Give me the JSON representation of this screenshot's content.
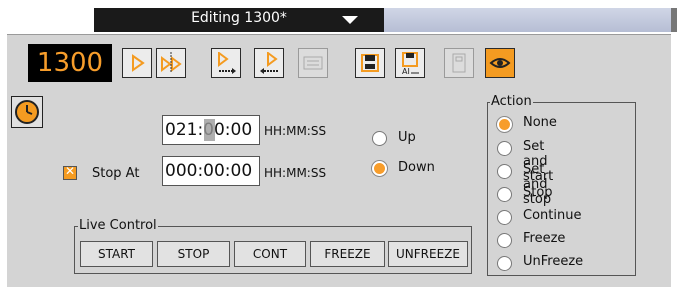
{
  "title": {
    "text": "Editing 1300*"
  },
  "counter": "1300",
  "toolbar": {
    "buttons": [
      "play",
      "play-step",
      "play-next",
      "play-prev",
      "properties",
      "save",
      "save-as",
      "document",
      "view"
    ]
  },
  "timer": {
    "time_value": "021:00:00",
    "time_unit": "HH:MM:SS",
    "stop_label": "Stop At",
    "stop_checked": true,
    "stop_value": "000:00:00",
    "stop_unit": "HH:MM:SS",
    "direction": {
      "up_label": "Up",
      "down_label": "Down",
      "selected": "Down"
    }
  },
  "action": {
    "title": "Action",
    "selected": "None",
    "options": [
      "None",
      "Set and start",
      "Set and stop",
      "Stop",
      "Continue",
      "Freeze",
      "UnFreeze"
    ]
  },
  "live_control": {
    "title": "Live Control",
    "buttons": [
      "START",
      "STOP",
      "CONT",
      "FREEZE",
      "UNFREEZE"
    ]
  },
  "colors": {
    "accent": "#f79d2b",
    "panel": "#d4d4d4",
    "counter_bg": "#000000"
  }
}
